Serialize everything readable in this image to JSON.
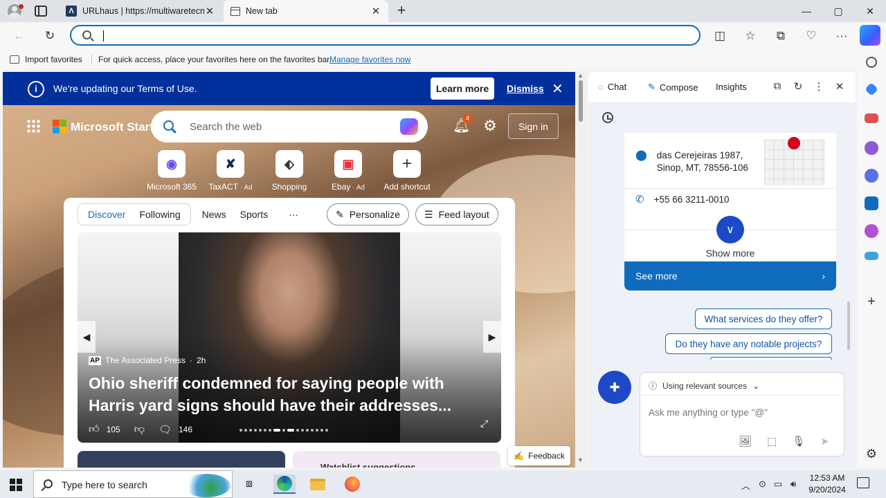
{
  "browser": {
    "tabs": [
      {
        "title": "URLhaus | https://multiwaretecnologia.com.br/",
        "close": "✕"
      },
      {
        "title": "New tab",
        "close": "✕"
      }
    ],
    "new_tab": "+",
    "window": {
      "minimize": "—",
      "maximize": "▢",
      "close": "✕"
    },
    "address_value": "",
    "favorites_bar": {
      "import": "Import favorites",
      "message": "For quick access, place your favorites here on the favorites bar.",
      "manage_link": "Manage favorites now"
    }
  },
  "newtab": {
    "banner": {
      "text": "We're updating our Terms of Use.",
      "learn_more": "Learn more",
      "dismiss": "Dismiss",
      "info": "i"
    },
    "brand": "Microsoft Start",
    "search_placeholder": "Search the web",
    "notifications_count": "4",
    "sign_in": "Sign in",
    "shortcuts": [
      {
        "label": "Microsoft 365",
        "ad": ""
      },
      {
        "label": "TaxACT",
        "ad": "Ad"
      },
      {
        "label": "Shopping",
        "ad": ""
      },
      {
        "label": "Ebay",
        "ad": "Ad"
      },
      {
        "label": "Add shortcut",
        "ad": ""
      }
    ],
    "feed_tabs": {
      "discover": "Discover",
      "following": "Following",
      "news": "News",
      "sports": "Sports",
      "more": "···"
    },
    "personalize": "Personalize",
    "feed_layout": "Feed layout",
    "hero": {
      "source": "The Associated Press",
      "source_badge": "AP",
      "age": "2h",
      "headline": "Ohio sheriff condemned for saying people with Harris yard signs should have their addresses...",
      "likes": "105",
      "comments": "146"
    },
    "watchlist": "Watchlist suggestions",
    "feedback": "Feedback"
  },
  "copilot": {
    "tabs": {
      "chat": "Chat",
      "compose": "Compose",
      "insights": "Insights"
    },
    "address_line1": "das Cerejeiras 1987,",
    "address_line2": "Sinop, MT, 78556-106",
    "phone": "+55 66 3211-0010",
    "show_more": "Show more",
    "see_more": "See more",
    "suggestions": [
      "What services do they offer?",
      "Do they have any notable projects?"
    ],
    "sources_label": "Using relevant sources",
    "input_placeholder": "Ask me anything or type \"@\""
  },
  "taskbar": {
    "search_placeholder": "Type here to search",
    "time": "12:53 AM",
    "date": "9/20/2024"
  },
  "colors": {
    "accent": "#0f6cbd",
    "banner": "#00309c",
    "copilot_blue": "#1d49c9"
  }
}
